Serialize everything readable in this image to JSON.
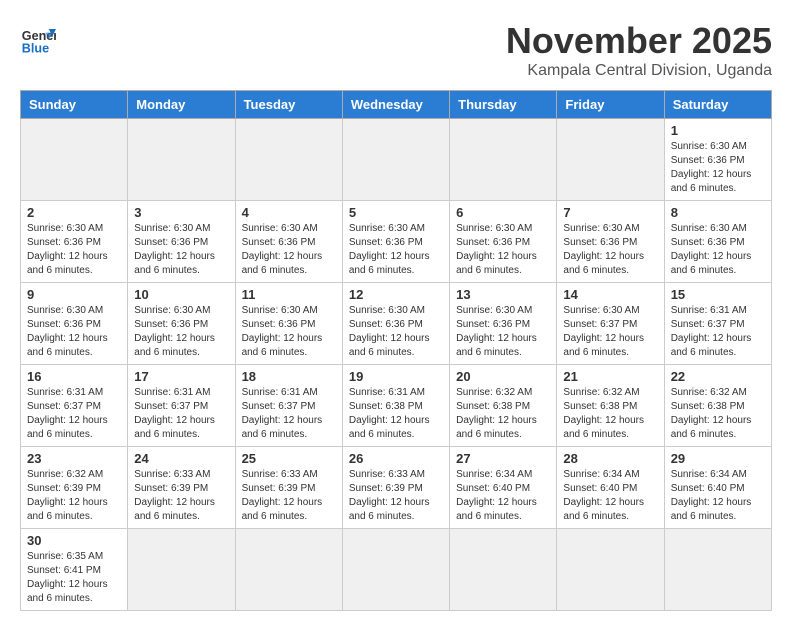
{
  "logo": {
    "general": "General",
    "blue": "Blue"
  },
  "header": {
    "title": "November 2025",
    "subtitle": "Kampala Central Division, Uganda"
  },
  "weekdays": [
    "Sunday",
    "Monday",
    "Tuesday",
    "Wednesday",
    "Thursday",
    "Friday",
    "Saturday"
  ],
  "weeks": [
    [
      {
        "day": "",
        "info": "",
        "empty": true
      },
      {
        "day": "",
        "info": "",
        "empty": true
      },
      {
        "day": "",
        "info": "",
        "empty": true
      },
      {
        "day": "",
        "info": "",
        "empty": true
      },
      {
        "day": "",
        "info": "",
        "empty": true
      },
      {
        "day": "",
        "info": "",
        "empty": true
      },
      {
        "day": "1",
        "info": "Sunrise: 6:30 AM\nSunset: 6:36 PM\nDaylight: 12 hours and 6 minutes.",
        "empty": false
      }
    ],
    [
      {
        "day": "2",
        "info": "Sunrise: 6:30 AM\nSunset: 6:36 PM\nDaylight: 12 hours and 6 minutes.",
        "empty": false
      },
      {
        "day": "3",
        "info": "Sunrise: 6:30 AM\nSunset: 6:36 PM\nDaylight: 12 hours and 6 minutes.",
        "empty": false
      },
      {
        "day": "4",
        "info": "Sunrise: 6:30 AM\nSunset: 6:36 PM\nDaylight: 12 hours and 6 minutes.",
        "empty": false
      },
      {
        "day": "5",
        "info": "Sunrise: 6:30 AM\nSunset: 6:36 PM\nDaylight: 12 hours and 6 minutes.",
        "empty": false
      },
      {
        "day": "6",
        "info": "Sunrise: 6:30 AM\nSunset: 6:36 PM\nDaylight: 12 hours and 6 minutes.",
        "empty": false
      },
      {
        "day": "7",
        "info": "Sunrise: 6:30 AM\nSunset: 6:36 PM\nDaylight: 12 hours and 6 minutes.",
        "empty": false
      },
      {
        "day": "8",
        "info": "Sunrise: 6:30 AM\nSunset: 6:36 PM\nDaylight: 12 hours and 6 minutes.",
        "empty": false
      }
    ],
    [
      {
        "day": "9",
        "info": "Sunrise: 6:30 AM\nSunset: 6:36 PM\nDaylight: 12 hours and 6 minutes.",
        "empty": false
      },
      {
        "day": "10",
        "info": "Sunrise: 6:30 AM\nSunset: 6:36 PM\nDaylight: 12 hours and 6 minutes.",
        "empty": false
      },
      {
        "day": "11",
        "info": "Sunrise: 6:30 AM\nSunset: 6:36 PM\nDaylight: 12 hours and 6 minutes.",
        "empty": false
      },
      {
        "day": "12",
        "info": "Sunrise: 6:30 AM\nSunset: 6:36 PM\nDaylight: 12 hours and 6 minutes.",
        "empty": false
      },
      {
        "day": "13",
        "info": "Sunrise: 6:30 AM\nSunset: 6:36 PM\nDaylight: 12 hours and 6 minutes.",
        "empty": false
      },
      {
        "day": "14",
        "info": "Sunrise: 6:30 AM\nSunset: 6:37 PM\nDaylight: 12 hours and 6 minutes.",
        "empty": false
      },
      {
        "day": "15",
        "info": "Sunrise: 6:31 AM\nSunset: 6:37 PM\nDaylight: 12 hours and 6 minutes.",
        "empty": false
      }
    ],
    [
      {
        "day": "16",
        "info": "Sunrise: 6:31 AM\nSunset: 6:37 PM\nDaylight: 12 hours and 6 minutes.",
        "empty": false
      },
      {
        "day": "17",
        "info": "Sunrise: 6:31 AM\nSunset: 6:37 PM\nDaylight: 12 hours and 6 minutes.",
        "empty": false
      },
      {
        "day": "18",
        "info": "Sunrise: 6:31 AM\nSunset: 6:37 PM\nDaylight: 12 hours and 6 minutes.",
        "empty": false
      },
      {
        "day": "19",
        "info": "Sunrise: 6:31 AM\nSunset: 6:38 PM\nDaylight: 12 hours and 6 minutes.",
        "empty": false
      },
      {
        "day": "20",
        "info": "Sunrise: 6:32 AM\nSunset: 6:38 PM\nDaylight: 12 hours and 6 minutes.",
        "empty": false
      },
      {
        "day": "21",
        "info": "Sunrise: 6:32 AM\nSunset: 6:38 PM\nDaylight: 12 hours and 6 minutes.",
        "empty": false
      },
      {
        "day": "22",
        "info": "Sunrise: 6:32 AM\nSunset: 6:38 PM\nDaylight: 12 hours and 6 minutes.",
        "empty": false
      }
    ],
    [
      {
        "day": "23",
        "info": "Sunrise: 6:32 AM\nSunset: 6:39 PM\nDaylight: 12 hours and 6 minutes.",
        "empty": false
      },
      {
        "day": "24",
        "info": "Sunrise: 6:33 AM\nSunset: 6:39 PM\nDaylight: 12 hours and 6 minutes.",
        "empty": false
      },
      {
        "day": "25",
        "info": "Sunrise: 6:33 AM\nSunset: 6:39 PM\nDaylight: 12 hours and 6 minutes.",
        "empty": false
      },
      {
        "day": "26",
        "info": "Sunrise: 6:33 AM\nSunset: 6:39 PM\nDaylight: 12 hours and 6 minutes.",
        "empty": false
      },
      {
        "day": "27",
        "info": "Sunrise: 6:34 AM\nSunset: 6:40 PM\nDaylight: 12 hours and 6 minutes.",
        "empty": false
      },
      {
        "day": "28",
        "info": "Sunrise: 6:34 AM\nSunset: 6:40 PM\nDaylight: 12 hours and 6 minutes.",
        "empty": false
      },
      {
        "day": "29",
        "info": "Sunrise: 6:34 AM\nSunset: 6:40 PM\nDaylight: 12 hours and 6 minutes.",
        "empty": false
      }
    ],
    [
      {
        "day": "30",
        "info": "Sunrise: 6:35 AM\nSunset: 6:41 PM\nDaylight: 12 hours and 6 minutes.",
        "empty": false
      },
      {
        "day": "",
        "info": "",
        "empty": true
      },
      {
        "day": "",
        "info": "",
        "empty": true
      },
      {
        "day": "",
        "info": "",
        "empty": true
      },
      {
        "day": "",
        "info": "",
        "empty": true
      },
      {
        "day": "",
        "info": "",
        "empty": true
      },
      {
        "day": "",
        "info": "",
        "empty": true
      }
    ]
  ]
}
